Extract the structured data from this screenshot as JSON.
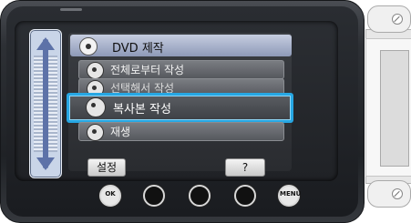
{
  "menu": {
    "header_label": "DVD 제작",
    "items": [
      {
        "label": "전체로부터 작성"
      },
      {
        "label": "선택해서 작성"
      },
      {
        "label": "복사본 작성"
      },
      {
        "label": "재생"
      }
    ],
    "selected_index": 2
  },
  "bottom_buttons": {
    "settings_label": "설정",
    "help_label": "?"
  },
  "touch_pad": {
    "ok_label": "OK",
    "menu_label": "MENU"
  },
  "colors": {
    "selection_border": "#27a7e3",
    "slider_fill": "#c9d5e8",
    "slider_arrow": "#5d72a8"
  }
}
